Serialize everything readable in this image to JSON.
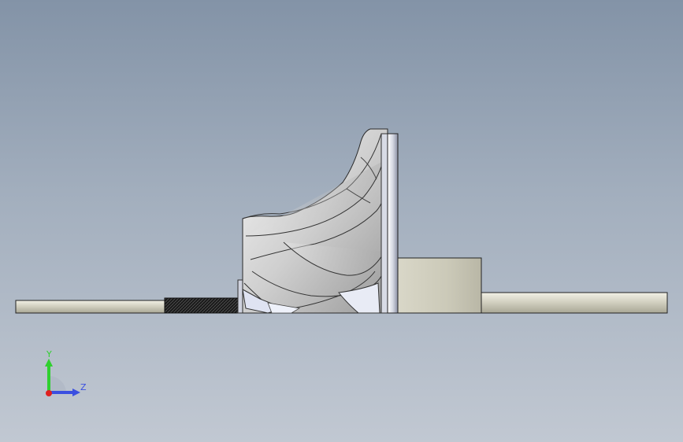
{
  "viewport": {
    "background_top": "#8393a7",
    "background_bottom": "#c1c8d2"
  },
  "model": {
    "part": "impeller-shaft-assembly",
    "view": "side"
  },
  "triad": {
    "y_label": "Y",
    "z_label": "Z",
    "y_color": "#2fd02f",
    "z_color": "#3a4fe0",
    "x_color": "#e02020"
  }
}
